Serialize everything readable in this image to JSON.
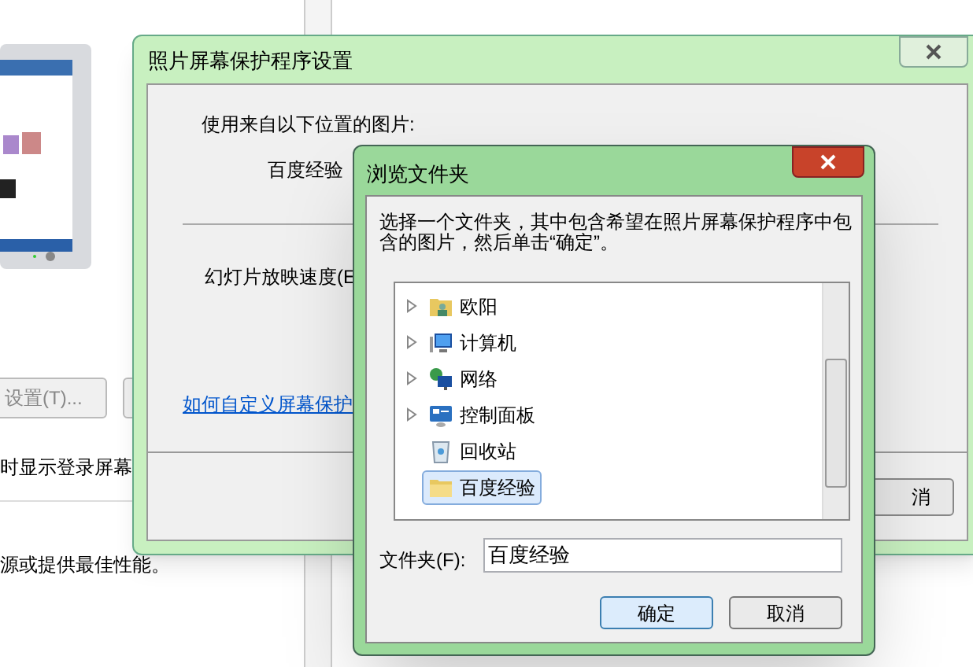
{
  "background_window": {
    "settings_button": "设置(T)...",
    "login_text": "时显示登录屏幕",
    "power_text": "源或提供最佳性能。"
  },
  "photo_dialog": {
    "title": "照片屏幕保护程序设置",
    "source_label": "使用来自以下位置的图片:",
    "source_value": "百度经验",
    "speed_label": "幻灯片放映速度(E",
    "help_link": "如何自定义屏幕保护",
    "cancel_button": "消"
  },
  "browse_dialog": {
    "title": "浏览文件夹",
    "instruction": "选择一个文件夹，其中包含希望在照片屏幕保护程序中包含的图片，然后单击“确定”。",
    "tree": [
      {
        "label": "欧阳",
        "kind": "user",
        "expandable": true,
        "selected": false
      },
      {
        "label": "计算机",
        "kind": "computer",
        "expandable": true,
        "selected": false
      },
      {
        "label": "网络",
        "kind": "network",
        "expandable": true,
        "selected": false
      },
      {
        "label": "控制面板",
        "kind": "control",
        "expandable": true,
        "selected": false
      },
      {
        "label": "回收站",
        "kind": "bin",
        "expandable": false,
        "selected": false
      },
      {
        "label": "百度经验",
        "kind": "folder",
        "expandable": false,
        "selected": true
      }
    ],
    "folder_label": "文件夹(F):",
    "folder_value": "百度经验",
    "ok_button": "确定",
    "cancel_button": "取消"
  }
}
